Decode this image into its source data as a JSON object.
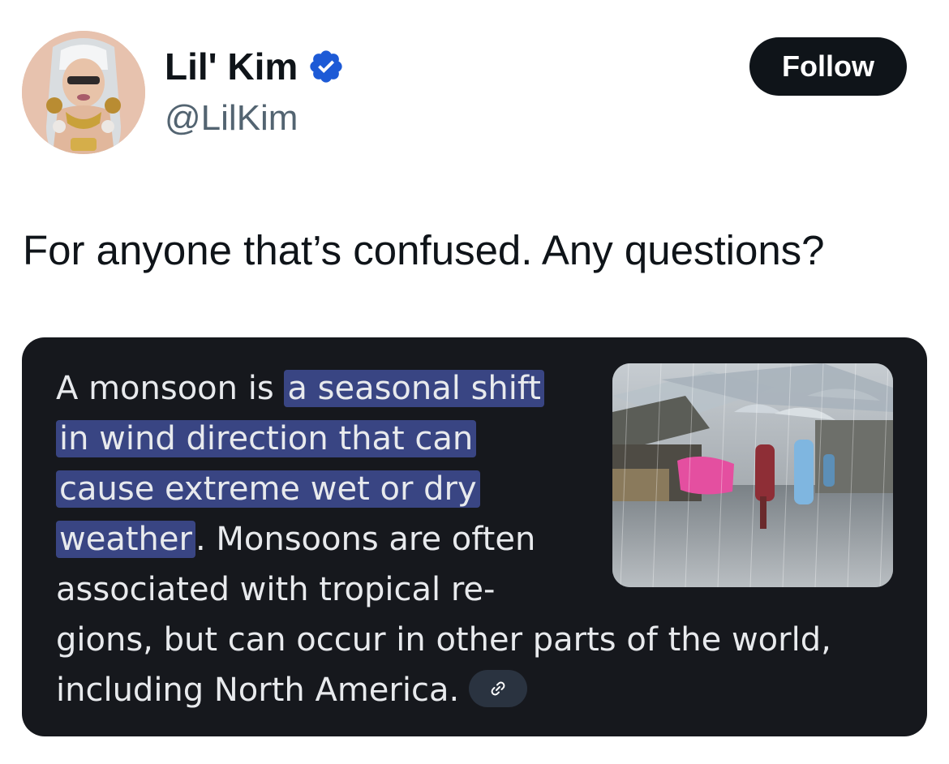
{
  "author": {
    "display_name": "Lil' Kim",
    "handle": "@LilKim",
    "verified": true,
    "avatar_icon": "profile-photo",
    "verified_icon": "verified-badge-icon"
  },
  "follow_button": {
    "label": "Follow"
  },
  "tweet": {
    "text": "For anyone that’s confused. Any questions?"
  },
  "card": {
    "lines": [
      {
        "before": "A monsoon is ",
        "highlight": "a seasonal shift",
        "after": ""
      },
      {
        "before": "",
        "highlight": "in wind direction that can",
        "after": ""
      },
      {
        "before": "",
        "highlight": "cause extreme wet or dry",
        "after": ""
      },
      {
        "before": "",
        "highlight": "weather",
        "after": ". Monsoons are often"
      },
      {
        "before": "associated with tropical re-",
        "highlight": "",
        "after": ""
      },
      {
        "before": "gions, but can occur in other parts of the world,",
        "highlight": "",
        "after": ""
      },
      {
        "before": "including North America.",
        "highlight": "",
        "after": ""
      }
    ],
    "link_icon": "link-icon",
    "image_icon": "monsoon-rain-photo"
  },
  "colors": {
    "text_primary": "#0f1419",
    "text_secondary": "#536471",
    "verified_blue": "#1d9bf0",
    "card_background": "#16181d",
    "highlight": "#394583"
  }
}
